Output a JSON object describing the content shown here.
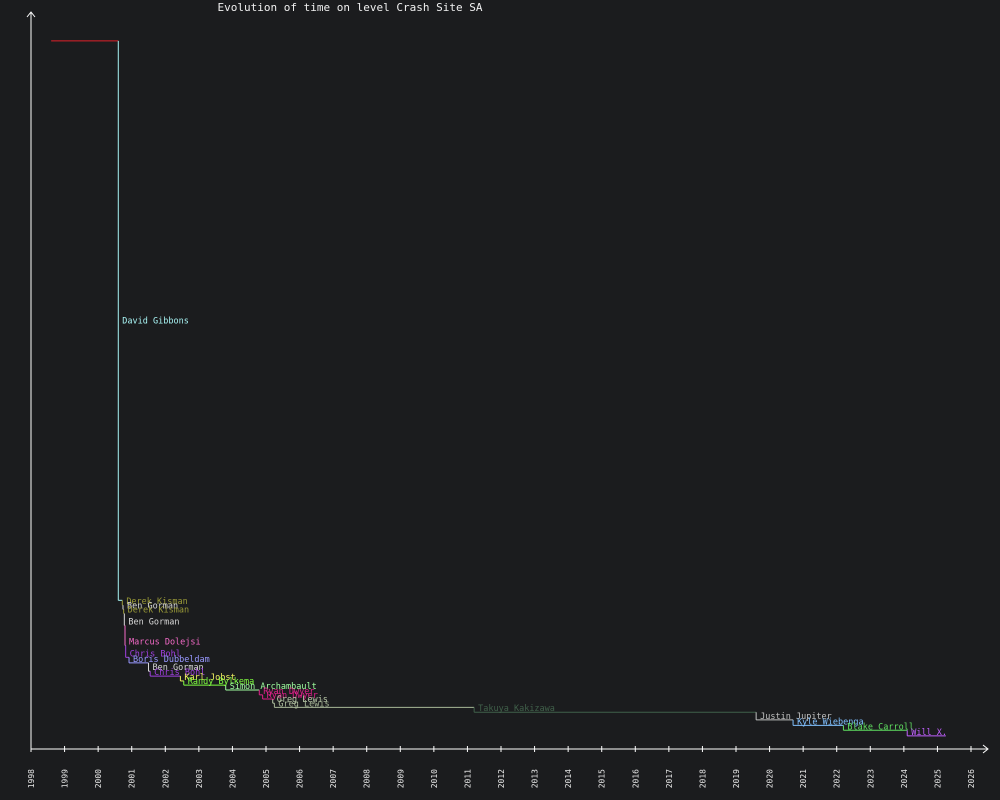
{
  "chart_data": {
    "type": "line",
    "title": "Evolution of time on level Crash Site SA",
    "x_ticks": [
      "1998",
      "1999",
      "2000",
      "2001",
      "2002",
      "2003",
      "2004",
      "2005",
      "2006",
      "2007",
      "2008",
      "2009",
      "2010",
      "2011",
      "2012",
      "2013",
      "2014",
      "2015",
      "2016",
      "2017",
      "2018",
      "2019",
      "2020",
      "2021",
      "2022",
      "2023",
      "2024",
      "2025",
      "2026"
    ],
    "xlim": [
      1998,
      2026
    ],
    "grid": false,
    "colors": {
      "background": "#1b1c1e",
      "axis": "#ffffff"
    },
    "records": [
      {
        "name": "",
        "date": 1998.6,
        "end": 2000.6,
        "level": 0.97,
        "color": "#e0202a"
      },
      {
        "name": "David Gibbons",
        "date": 2000.6,
        "end": 2000.72,
        "level": 0.165,
        "color": "#a8f4f4"
      },
      {
        "name": "Derek Kisman",
        "date": 2000.72,
        "end": 2000.74,
        "level": 0.158,
        "color": "#9a9a38"
      },
      {
        "name": "Ben Gorman",
        "date": 2000.74,
        "end": 2000.76,
        "level": 0.152,
        "color": "#d8d8d8"
      },
      {
        "name": "Derek Kisman",
        "date": 2000.76,
        "end": 2000.78,
        "level": 0.146,
        "color": "#9a9a38"
      },
      {
        "name": "Ben Gorman",
        "date": 2000.78,
        "end": 2000.8,
        "level": 0.129,
        "color": "#d8d8d8"
      },
      {
        "name": "Marcus Dolejsi",
        "date": 2000.8,
        "end": 2000.82,
        "level": 0.1,
        "color": "#f46ac8"
      },
      {
        "name": "Chris Bohl",
        "date": 2000.82,
        "end": 2000.92,
        "level": 0.083,
        "color": "#a040e0"
      },
      {
        "name": "Boris Dubbeldam",
        "date": 2000.92,
        "end": 2001.5,
        "level": 0.075,
        "color": "#9898ff"
      },
      {
        "name": "Ben Gorman",
        "date": 2001.5,
        "end": 2001.55,
        "level": 0.063,
        "color": "#d8d8d8"
      },
      {
        "name": "Chris Bohl",
        "date": 2001.55,
        "end": 2002.45,
        "level": 0.056,
        "color": "#a040e0"
      },
      {
        "name": "Karl Jobst",
        "date": 2002.45,
        "end": 2002.55,
        "level": 0.049,
        "color": "#f0f060"
      },
      {
        "name": "Randy Bylkema",
        "date": 2002.55,
        "end": 2003.8,
        "level": 0.043,
        "color": "#80ff40"
      },
      {
        "name": "Simon Archambault",
        "date": 2003.8,
        "end": 2004.8,
        "level": 0.036,
        "color": "#a0ffa0"
      },
      {
        "name": "Ryan Dwyer",
        "date": 2004.8,
        "end": 2004.9,
        "level": 0.029,
        "color": "#e0208a"
      },
      {
        "name": "Ryan Dwyer",
        "date": 2004.9,
        "end": 2005.2,
        "level": 0.023,
        "color": "#e0208a"
      },
      {
        "name": "Greg Lewis",
        "date": 2005.2,
        "end": 2005.25,
        "level": 0.017,
        "color": "#b8c8a8"
      },
      {
        "name": "Greg Lewis",
        "date": 2005.25,
        "end": 2011.2,
        "level": 0.011,
        "color": "#a8b898"
      },
      {
        "name": "Takuya Kakizawa",
        "date": 2011.2,
        "end": 2019.6,
        "level": 0.004,
        "color": "#40604a"
      },
      {
        "name": "Justin Jupiter",
        "date": 2019.6,
        "end": 2020.7,
        "level": -0.007,
        "color": "#c0c0c0"
      },
      {
        "name": "Kyle Wiebenga",
        "date": 2020.7,
        "end": 2022.2,
        "level": -0.015,
        "color": "#80c0ff"
      },
      {
        "name": "Blake Carroll",
        "date": 2022.2,
        "end": 2024.1,
        "level": -0.022,
        "color": "#60e060"
      },
      {
        "name": "Will X.",
        "date": 2024.1,
        "end": 2025.25,
        "level": -0.03,
        "color": "#c060ff"
      }
    ]
  }
}
